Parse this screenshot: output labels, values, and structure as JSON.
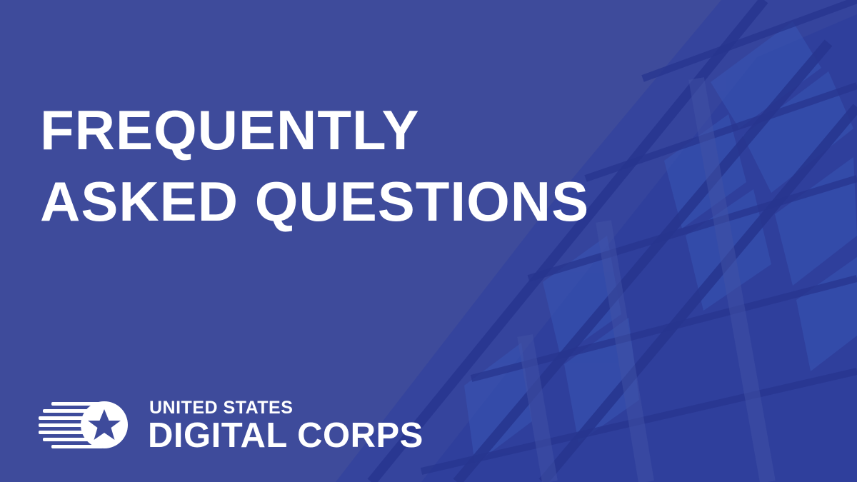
{
  "headline": {
    "line1": "FREQUENTLY",
    "line2": "ASKED QUESTIONS"
  },
  "logo": {
    "line1": "UNITED STATES",
    "line2": "DIGITAL CORPS",
    "mark_icon": "star-stripes-icon"
  },
  "background": {
    "icon": "office-building-icon"
  },
  "colors": {
    "background": "#3e4b9b",
    "text": "#ffffff",
    "building_shade": "#2b3a98",
    "window_tint": "#3a55b8"
  }
}
